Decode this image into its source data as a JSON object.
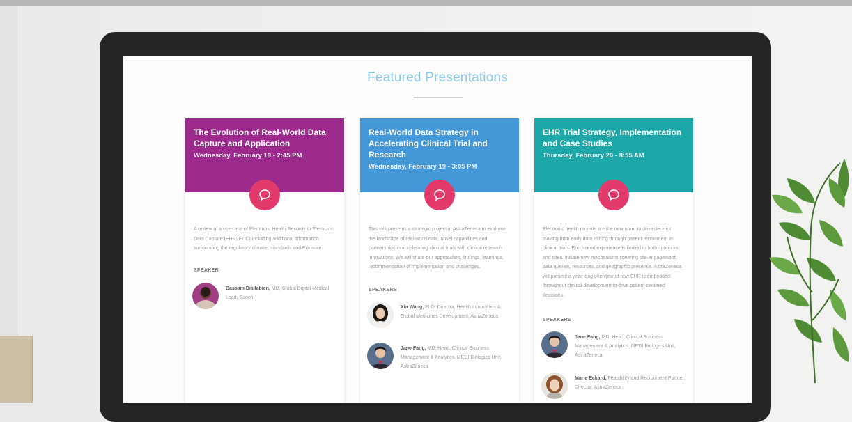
{
  "page": {
    "heading": "Featured Presentations"
  },
  "cards": [
    {
      "title": "The Evolution of Real-World Data Capture and Application",
      "date": "Wednesday, February 19 - 2:45 PM",
      "color": "#9c2a8c",
      "description": "A review of a use case of Electronic Health Records to Electronic Data Capture (EHR2EDC) including additional information surrounding the regulatory climate, standards and Eclosure.",
      "speakers_label": "SPEAKER",
      "speakers": [
        {
          "name": "Bassam Diallabien,",
          "detail": "MD, Global Digital Medical Lead, Sanofi"
        }
      ]
    },
    {
      "title": "Real-World Data Strategy in Accelerating Clinical Trial and Research",
      "date": "Wednesday, February 19 - 3:05 PM",
      "color": "#4598d8",
      "description": "This talk presents a strategic project in AstraZeneca to evaluate the landscape of real-world data, novel capabilities and partnerships in accelerating clinical trials with clinical research innovations. We will share our approaches, findings, learnings, recommendation of implementation and challenges.",
      "speakers_label": "SPEAKERS",
      "speakers": [
        {
          "name": "Xia Wang,",
          "detail": "PhD, Director, Health Informatics & Global Medicines Development, AstraZeneca"
        },
        {
          "name": "Jane Fang,",
          "detail": "MD, Head, Clinical Business Management & Analytics, MEDI Biologics Unit, AstraZeneca"
        }
      ]
    },
    {
      "title": "EHR Trial Strategy, Implementation and Case Studies",
      "date": "Thursday, February 20 - 8:55 AM",
      "color": "#1ea7a8",
      "description": "Electronic health records are the new norm to drive decision making from early data mining through patient recruitment in clinical trials. End to end experience is limited to both sponsors and sites. Initiate new mechanisms covering site engagement, data queries, resources, and geographic presence. AstraZeneca will present a year-long overview of how EHR is embedded throughout clinical development to drive patient-centered decisions.",
      "speakers_label": "SPEAKERS",
      "speakers": [
        {
          "name": "Jane Fang,",
          "detail": "MD, Head, Clinical Business Management & Analytics, MEDI Biologics Unit, AstraZeneca"
        },
        {
          "name": "Marie Eckard,",
          "detail": "Feasibility and Recruitment Partner, Director, AstraZeneca"
        }
      ]
    }
  ],
  "colors": {
    "bubble": "#e23b6b",
    "heading": "#8ac9e3"
  }
}
